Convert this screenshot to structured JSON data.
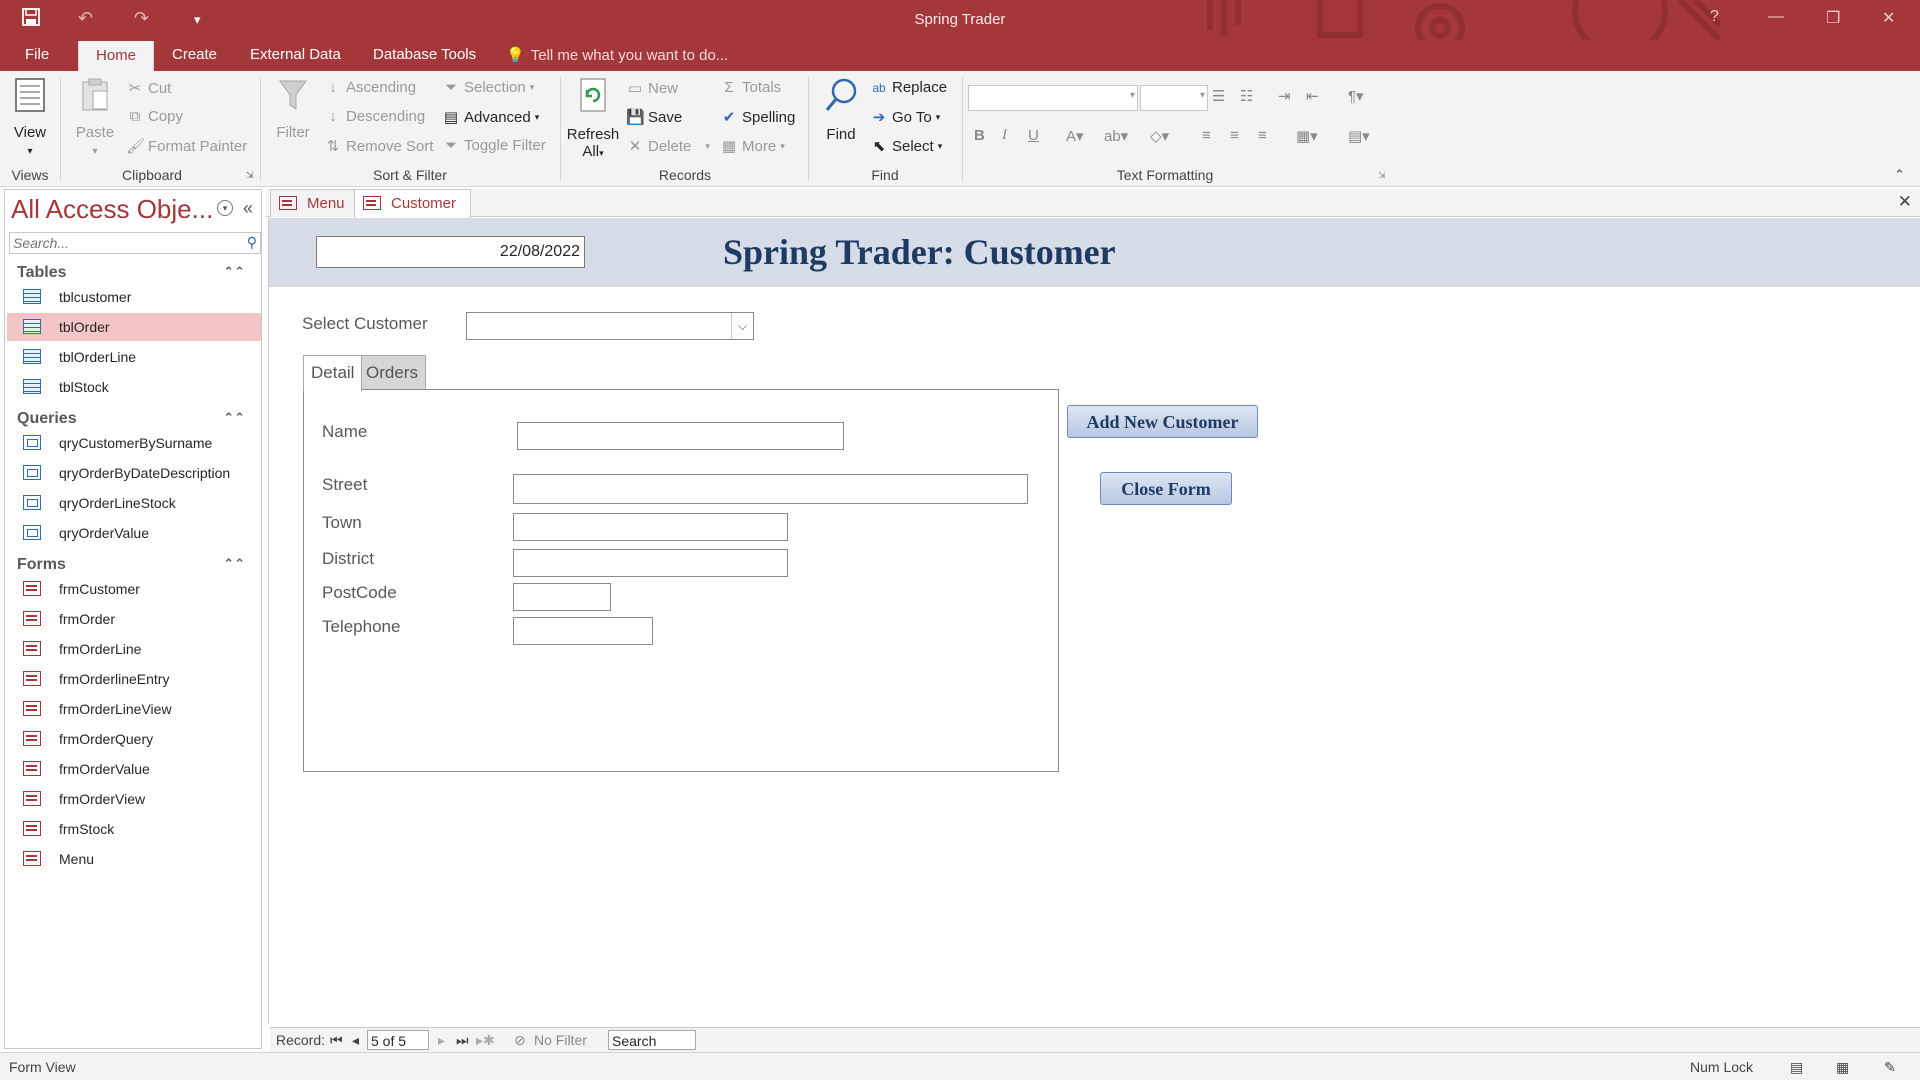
{
  "window": {
    "title": "Spring Trader"
  },
  "ribbon_tabs": {
    "file": "File",
    "home": "Home",
    "create": "Create",
    "external": "External Data",
    "dbtools": "Database Tools",
    "tellme": "Tell me what you want to do..."
  },
  "ribbon": {
    "views": {
      "view": "View",
      "group": "Views"
    },
    "clipboard": {
      "paste": "Paste",
      "cut": "Cut",
      "copy": "Copy",
      "format_painter": "Format Painter",
      "group": "Clipboard"
    },
    "sort_filter": {
      "filter": "Filter",
      "ascending": "Ascending",
      "descending": "Descending",
      "remove_sort": "Remove Sort",
      "selection": "Selection",
      "advanced": "Advanced",
      "toggle_filter": "Toggle Filter",
      "group": "Sort & Filter"
    },
    "records": {
      "refresh": "Refresh",
      "all": "All",
      "new": "New",
      "save": "Save",
      "delete": "Delete",
      "totals": "Totals",
      "spelling": "Spelling",
      "more": "More",
      "group": "Records"
    },
    "find": {
      "find": "Find",
      "replace": "Replace",
      "goto": "Go To",
      "select": "Select",
      "group": "Find"
    },
    "text_formatting": {
      "group": "Text Formatting"
    }
  },
  "nav": {
    "title": "All Access Obje...",
    "search_placeholder": "Search...",
    "tables_header": "Tables",
    "tables": [
      "tblcustomer",
      "tblOrder",
      "tblOrderLine",
      "tblStock"
    ],
    "queries_header": "Queries",
    "queries": [
      "qryCustomerBySurname",
      "qryOrderByDateDescription",
      "qryOrderLineStock",
      "qryOrderValue"
    ],
    "forms_header": "Forms",
    "forms": [
      "frmCustomer",
      "frmOrder",
      "frmOrderLine",
      "frmOrderlineEntry",
      "frmOrderLineView",
      "frmOrderQuery",
      "frmOrderValue",
      "frmOrderView",
      "frmStock",
      "Menu"
    ]
  },
  "doc_tabs": {
    "menu": "Menu",
    "customer": "Customer"
  },
  "form": {
    "date": "22/08/2022",
    "title": "Spring Trader: Customer",
    "select_customer_label": "Select Customer",
    "tab_detail": "Detail",
    "tab_orders": "Orders",
    "labels": {
      "name": "Name",
      "street": "Street",
      "town": "Town",
      "district": "District",
      "postcode": "PostCode",
      "telephone": "Telephone"
    },
    "add_new_customer": "Add New Customer",
    "close_form": "Close Form"
  },
  "record_nav": {
    "label": "Record:",
    "position": "5 of 5",
    "filter": "No Filter",
    "search": "Search"
  },
  "status": {
    "view": "Form View",
    "numlock": "Num Lock"
  },
  "colors": {
    "accent": "#a4373a",
    "header_band": "#d6dde8",
    "title_text": "#1f3a63"
  }
}
